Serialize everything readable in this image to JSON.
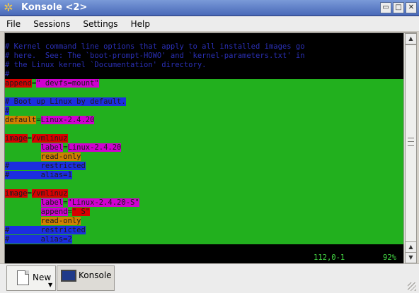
{
  "window": {
    "title": "Konsole <2>",
    "app_icon": "sun-gear-icon",
    "buttons": [
      {
        "name": "minimize-button",
        "glyph": "▭"
      },
      {
        "name": "maximize-button",
        "glyph": "□"
      },
      {
        "name": "close-button",
        "glyph": "✕"
      }
    ]
  },
  "menu": [
    "File",
    "Sessions",
    "Settings",
    "Help"
  ],
  "colors": {
    "comment": "#2a2fb4",
    "green_bg": "#22b01e",
    "keyword_bg": "#d80000",
    "value_bg": "#d000d0",
    "orange_bg": "#d08000",
    "blue_bg": "#1c2ee0",
    "dark_text": "#1c1c1c",
    "status_text": "#44d844"
  },
  "terminal": {
    "lines": [
      {
        "segments": [
          {
            "text": "# Kernel command line options that apply to all installed images go",
            "role": "comment"
          }
        ]
      },
      {
        "segments": [
          {
            "text": "# here.  See: The `boot-prompt-HOWO' and `kernel-parameters.txt' in",
            "role": "comment"
          }
        ]
      },
      {
        "segments": [
          {
            "text": "# the Linux kernel `Documentation' directory.",
            "role": "comment"
          }
        ]
      },
      {
        "segments": [
          {
            "text": "#",
            "role": "comment"
          }
        ]
      },
      {
        "segments": [
          {
            "text": "append",
            "role": "keyword"
          },
          {
            "text": "=",
            "role": "equals"
          },
          {
            "text": "\" devfs=mount\"",
            "role": "value"
          }
        ]
      },
      {
        "segments": [
          {
            "text": "",
            "role": "green"
          }
        ]
      },
      {
        "segments": [
          {
            "text": "# Boot up Linux by default.",
            "role": "blue"
          }
        ]
      },
      {
        "segments": [
          {
            "text": "#",
            "role": "blue"
          }
        ]
      },
      {
        "segments": [
          {
            "text": "default",
            "role": "orange"
          },
          {
            "text": "=",
            "role": "equals"
          },
          {
            "text": "Linux-2.4.20",
            "role": "value"
          }
        ]
      },
      {
        "segments": [
          {
            "text": "",
            "role": "green"
          }
        ]
      },
      {
        "segments": [
          {
            "text": "image",
            "role": "keyword"
          },
          {
            "text": "=",
            "role": "equals"
          },
          {
            "text": "/vmlinuz",
            "role": "keyword"
          }
        ]
      },
      {
        "segments": [
          {
            "text": "        ",
            "role": "green"
          },
          {
            "text": "label",
            "role": "value"
          },
          {
            "text": "=",
            "role": "equals"
          },
          {
            "text": "Linux-2.4.20",
            "role": "value"
          }
        ]
      },
      {
        "segments": [
          {
            "text": "        ",
            "role": "green"
          },
          {
            "text": "read-only",
            "role": "orange"
          }
        ]
      },
      {
        "segments": [
          {
            "text": "#       restricted",
            "role": "blue"
          }
        ]
      },
      {
        "segments": [
          {
            "text": "#       alias=1",
            "role": "blue"
          }
        ]
      },
      {
        "segments": [
          {
            "text": "",
            "role": "green"
          }
        ]
      },
      {
        "segments": [
          {
            "text": "image",
            "role": "keyword"
          },
          {
            "text": "=",
            "role": "equals"
          },
          {
            "text": "/vmlinuz",
            "role": "keyword"
          }
        ]
      },
      {
        "segments": [
          {
            "text": "        ",
            "role": "green"
          },
          {
            "text": "label",
            "role": "value"
          },
          {
            "text": "=",
            "role": "equals"
          },
          {
            "text": "\"Linux-2.4.20-S\"",
            "role": "value"
          }
        ]
      },
      {
        "segments": [
          {
            "text": "        ",
            "role": "green"
          },
          {
            "text": "append",
            "role": "value"
          },
          {
            "text": "=",
            "role": "equals"
          },
          {
            "text": "\" S\"",
            "role": "keyword"
          }
        ]
      },
      {
        "segments": [
          {
            "text": "        ",
            "role": "green"
          },
          {
            "text": "read-only",
            "role": "orange"
          }
        ]
      },
      {
        "segments": [
          {
            "text": "#       restricted",
            "role": "blue"
          }
        ]
      },
      {
        "segments": [
          {
            "text": "#       alias=2",
            "role": "blue"
          },
          {
            "text": " ",
            "role": "cursor"
          }
        ]
      }
    ],
    "status": {
      "position": "112,0-1",
      "percent": "92%"
    }
  },
  "tabs": {
    "new_label": "New",
    "new_icon": "new-document-icon",
    "konsole_label": "Konsole",
    "konsole_icon": "terminal-icon"
  }
}
